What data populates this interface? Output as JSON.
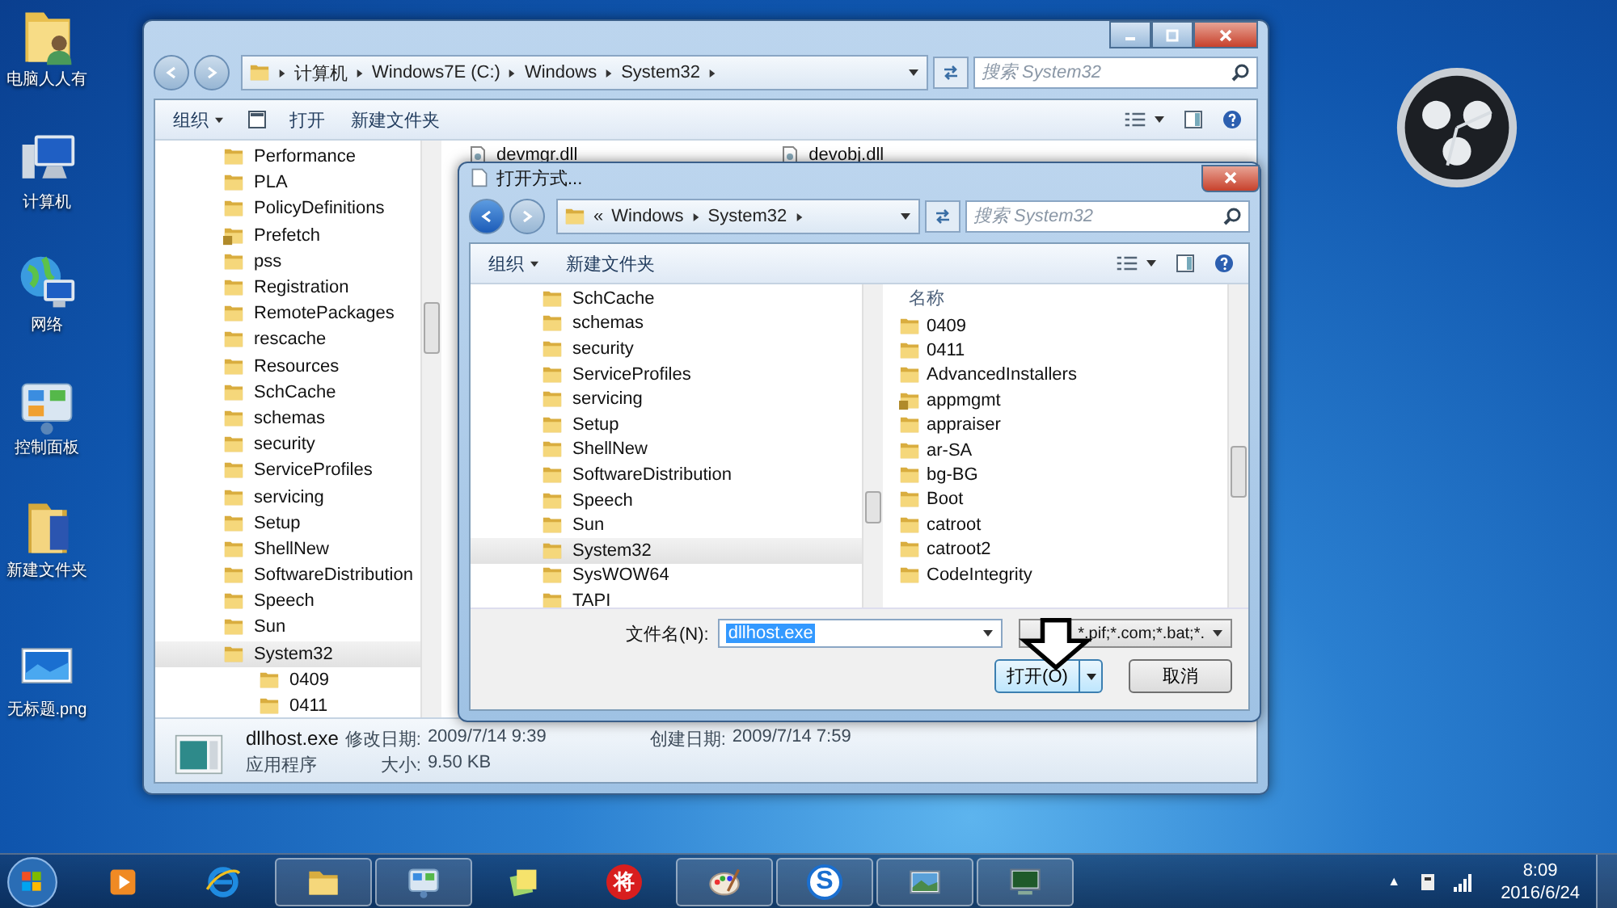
{
  "desktop_icons": [
    {
      "label": "电脑人人有",
      "kind": "user-folder"
    },
    {
      "label": "计算机",
      "kind": "computer"
    },
    {
      "label": "网络",
      "kind": "network"
    },
    {
      "label": "控制面板",
      "kind": "control-panel"
    },
    {
      "label": "新建文件夹",
      "kind": "folder"
    },
    {
      "label": "无标题.png",
      "kind": "image"
    }
  ],
  "explorer": {
    "breadcrumb": [
      "计算机",
      "Windows7E (C:)",
      "Windows",
      "System32"
    ],
    "search": {
      "placeholder": "搜索 System32"
    },
    "toolbar": {
      "organize": "组织",
      "open": "打开",
      "new_folder": "新建文件夹"
    },
    "nav_tree": [
      {
        "name": "Performance",
        "locked": false,
        "selected": false
      },
      {
        "name": "PLA",
        "locked": false,
        "selected": false
      },
      {
        "name": "PolicyDefinitions",
        "locked": false,
        "selected": false
      },
      {
        "name": "Prefetch",
        "locked": true,
        "selected": false
      },
      {
        "name": "pss",
        "locked": false,
        "selected": false
      },
      {
        "name": "Registration",
        "locked": false,
        "selected": false
      },
      {
        "name": "RemotePackages",
        "locked": false,
        "selected": false
      },
      {
        "name": "rescache",
        "locked": false,
        "selected": false
      },
      {
        "name": "Resources",
        "locked": false,
        "selected": false
      },
      {
        "name": "SchCache",
        "locked": false,
        "selected": false
      },
      {
        "name": "schemas",
        "locked": false,
        "selected": false
      },
      {
        "name": "security",
        "locked": false,
        "selected": false
      },
      {
        "name": "ServiceProfiles",
        "locked": false,
        "selected": false
      },
      {
        "name": "servicing",
        "locked": false,
        "selected": false
      },
      {
        "name": "Setup",
        "locked": false,
        "selected": false
      },
      {
        "name": "ShellNew",
        "locked": false,
        "selected": false
      },
      {
        "name": "SoftwareDistribution",
        "locked": false,
        "selected": false
      },
      {
        "name": "Speech",
        "locked": false,
        "selected": false
      },
      {
        "name": "Sun",
        "locked": false,
        "selected": false
      },
      {
        "name": "System32",
        "locked": false,
        "selected": true,
        "children": [
          {
            "name": "0409",
            "locked": false,
            "selected": false
          },
          {
            "name": "0411",
            "locked": false,
            "selected": false
          }
        ]
      }
    ],
    "files": [
      {
        "name": "devmgr.dll"
      },
      {
        "name": "devobj.dll"
      }
    ],
    "details": {
      "name": "dllhost.exe",
      "type": "应用程序",
      "modified_label": "修改日期:",
      "modified": "2009/7/14 9:39",
      "created_label": "创建日期:",
      "created": "2009/7/14 7:59",
      "size_label": "大小:",
      "size": "9.50 KB"
    }
  },
  "dialog": {
    "title": "打开方式...",
    "breadcrumb_prefix": "«",
    "breadcrumb": [
      "Windows",
      "System32"
    ],
    "search": {
      "placeholder": "搜索 System32"
    },
    "toolbar": {
      "organize": "组织",
      "new_folder": "新建文件夹"
    },
    "nav_tree": [
      {
        "name": "SchCache",
        "selected": false
      },
      {
        "name": "schemas",
        "selected": false
      },
      {
        "name": "security",
        "selected": false
      },
      {
        "name": "ServiceProfiles",
        "selected": false
      },
      {
        "name": "servicing",
        "selected": false
      },
      {
        "name": "Setup",
        "selected": false
      },
      {
        "name": "ShellNew",
        "selected": false
      },
      {
        "name": "SoftwareDistribution",
        "selected": false
      },
      {
        "name": "Speech",
        "selected": false
      },
      {
        "name": "Sun",
        "selected": false
      },
      {
        "name": "System32",
        "selected": true
      },
      {
        "name": "SysWOW64",
        "selected": false
      },
      {
        "name": "TAPI",
        "selected": false
      }
    ],
    "list_header": "名称",
    "files": [
      {
        "name": "0409",
        "locked": false
      },
      {
        "name": "0411",
        "locked": false
      },
      {
        "name": "AdvancedInstallers",
        "locked": false
      },
      {
        "name": "appmgmt",
        "locked": true
      },
      {
        "name": "appraiser",
        "locked": false
      },
      {
        "name": "ar-SA",
        "locked": false
      },
      {
        "name": "bg-BG",
        "locked": false
      },
      {
        "name": "Boot",
        "locked": false
      },
      {
        "name": "catroot",
        "locked": false
      },
      {
        "name": "catroot2",
        "locked": false
      },
      {
        "name": "CodeIntegrity",
        "locked": false
      }
    ],
    "filename_label": "文件名(N):",
    "filename": "dllhost.exe",
    "filetype": "*.pif;*.com;*.bat;*.",
    "open_button": "打开(O)",
    "cancel_button": "取消"
  },
  "taskbar": {
    "apps": [
      {
        "kind": "media",
        "running": false
      },
      {
        "kind": "browser",
        "running": false
      },
      {
        "kind": "folder",
        "running": true
      },
      {
        "kind": "control-panel",
        "running": true
      },
      {
        "kind": "sticky-notes",
        "running": false
      },
      {
        "kind": "chess",
        "glyph": "将",
        "running": false
      },
      {
        "kind": "paint",
        "running": true
      },
      {
        "kind": "sogou",
        "glyph": "S",
        "running": true
      },
      {
        "kind": "photo",
        "running": true
      },
      {
        "kind": "remote",
        "running": true
      }
    ],
    "tray_toggle": "▲",
    "clock": {
      "time": "8:09",
      "date": "2016/6/24"
    }
  }
}
